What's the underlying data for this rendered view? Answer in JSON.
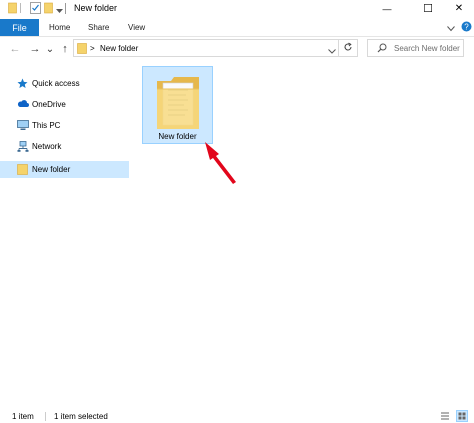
{
  "window": {
    "title": "New folder",
    "minimize_glyph": "—",
    "maximize_glyph": "☐",
    "close_glyph": "✕"
  },
  "ribbon": {
    "tabs": [
      "File",
      "Home",
      "Share",
      "View"
    ],
    "accent": "#1979ca"
  },
  "navigation": {
    "back_glyph": "←",
    "forward_glyph": "→",
    "recent_glyph": "⌄",
    "up_glyph": "↑",
    "address_separator": ">",
    "address": "New folder",
    "search_placeholder": "Search New folder"
  },
  "sidebar": {
    "items": [
      {
        "label": "Quick access",
        "icon": "star-icon"
      },
      {
        "label": "OneDrive",
        "icon": "cloud-icon"
      },
      {
        "label": "This PC",
        "icon": "computer-icon"
      },
      {
        "label": "Network",
        "icon": "network-icon"
      },
      {
        "label": "New folder",
        "icon": "folder-icon",
        "selected": true
      }
    ],
    "selection_color": "#cce8ff"
  },
  "content": {
    "items": [
      {
        "name": "New folder",
        "type": "folder",
        "selected": true
      }
    ]
  },
  "annotation": {
    "arrow_color": "#e2061b"
  },
  "status_bar": {
    "item_count": "1 item",
    "selection": "1 item selected"
  }
}
